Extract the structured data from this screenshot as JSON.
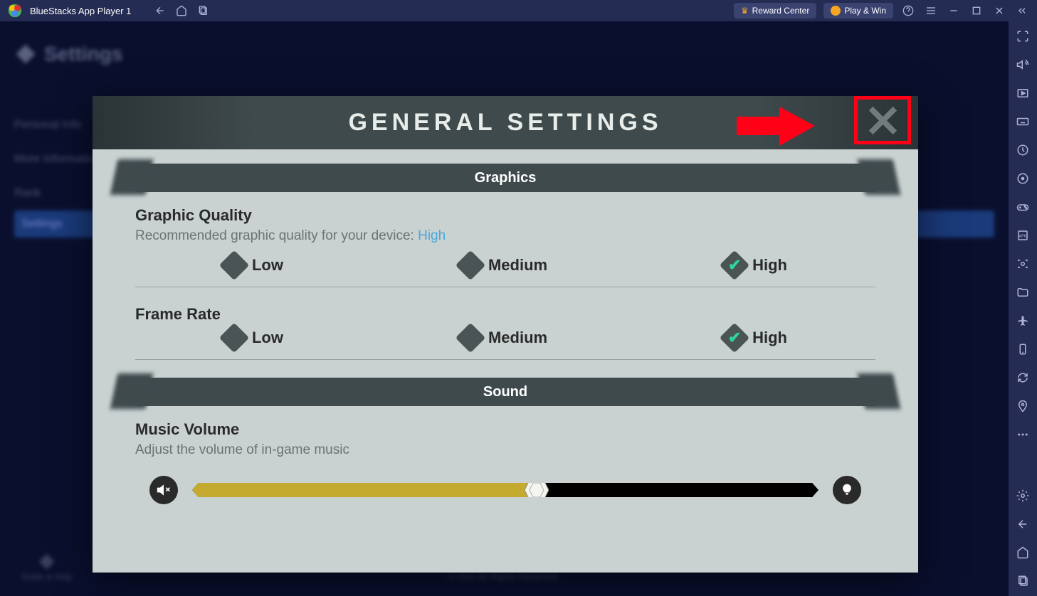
{
  "titlebar": {
    "app_name": "BlueStacks App Player 1",
    "reward_label": "Reward Center",
    "playwin_label": "Play & Win"
  },
  "background": {
    "settings_title": "Settings",
    "menu": {
      "personal": "Personal Info",
      "more": "More Information",
      "rank": "Rank",
      "settings": "Settings"
    },
    "footer": "© IGG All Rights Reserved.",
    "guide": "Guide & Help"
  },
  "modal": {
    "title": "GENERAL SETTINGS",
    "sections": {
      "graphics": {
        "banner": "Graphics",
        "quality": {
          "title": "Graphic Quality",
          "desc_prefix": "Recommended graphic quality for your device: ",
          "desc_value": "High",
          "options": [
            "Low",
            "Medium",
            "High"
          ],
          "selected": "High"
        },
        "framerate": {
          "title": "Frame Rate",
          "options": [
            "Low",
            "Medium",
            "High"
          ],
          "selected": "High"
        }
      },
      "sound": {
        "banner": "Sound",
        "music": {
          "title": "Music Volume",
          "desc": "Adjust the volume of in-game music",
          "value_percent": 55
        }
      }
    }
  }
}
